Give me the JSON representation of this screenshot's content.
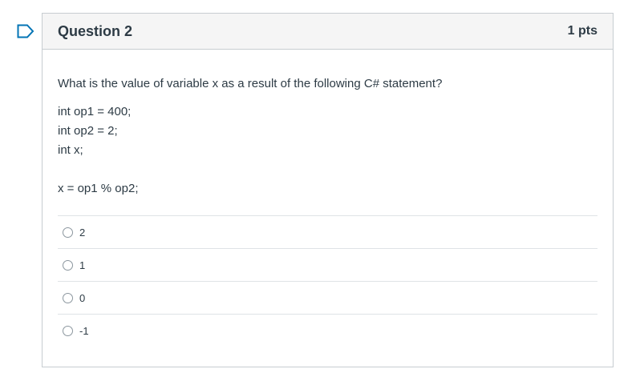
{
  "question": {
    "title": "Question 2",
    "points": "1 pts",
    "prompt": "What is the value of variable x as a result of the following C# statement?",
    "code_lines": [
      "int op1 = 400;",
      "int op2 = 2;",
      "int x;"
    ],
    "statement": "x = op1 % op2;",
    "flag_icon": "flag-outline-icon",
    "accent_color": "#0374b5"
  },
  "answers": [
    {
      "label": "2"
    },
    {
      "label": "1"
    },
    {
      "label": "0"
    },
    {
      "label": "-1"
    }
  ]
}
